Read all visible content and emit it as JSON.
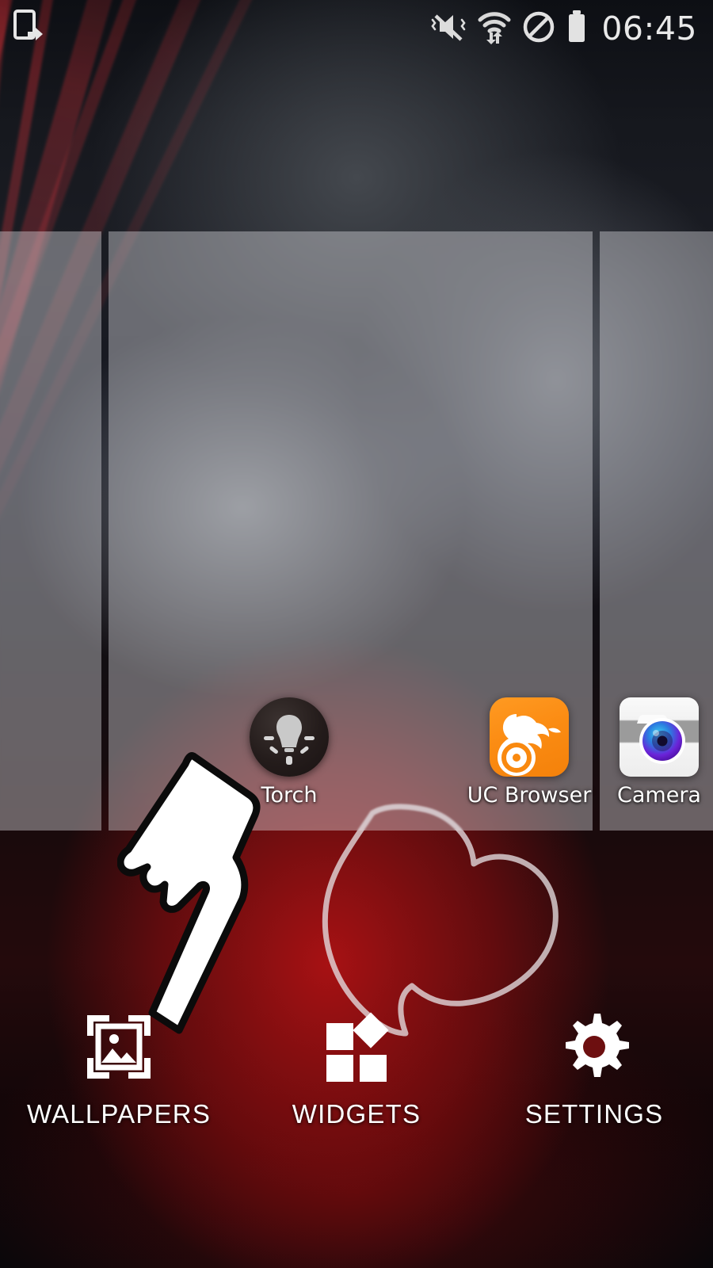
{
  "statusbar": {
    "left_icons": [
      {
        "name": "screenshot-share-icon",
        "glyph": "phone-arrow"
      }
    ],
    "right_icons": [
      {
        "name": "vibrate-mute-icon",
        "glyph": "speaker-muted-vibrate"
      },
      {
        "name": "wifi-data-icon",
        "glyph": "wifi-with-updown-arrows"
      },
      {
        "name": "do-not-disturb-icon",
        "glyph": "circle-slash"
      },
      {
        "name": "battery-icon",
        "glyph": "battery-full"
      }
    ],
    "clock": "06:45"
  },
  "home": {
    "mode": "edit-overview",
    "pages": [
      {
        "name": "page-preview-left",
        "position": "left"
      },
      {
        "name": "page-preview-center",
        "position": "center"
      },
      {
        "name": "page-preview-right",
        "position": "right"
      }
    ]
  },
  "apps": [
    {
      "label": "Torch",
      "icon": "torch-icon"
    },
    {
      "label": "UC Browser",
      "icon": "uc-browser-icon"
    },
    {
      "label": "Camera",
      "icon": "camera-icon"
    }
  ],
  "actionbar": [
    {
      "label": "WALLPAPERS",
      "icon": "wallpapers-icon"
    },
    {
      "label": "WIDGETS",
      "icon": "widgets-icon"
    },
    {
      "label": "SETTINGS",
      "icon": "settings-gear-icon"
    }
  ],
  "pointer": {
    "name": "hand-pointer-cursor",
    "target": "WALLPAPERS"
  },
  "colors": {
    "accent_red": "#b21214",
    "uc_orange": "#f9890f",
    "icon_white": "#ffffff",
    "panel_overlay": "rgba(228,228,232,0.40)",
    "status_text": "#e9e9e9"
  }
}
